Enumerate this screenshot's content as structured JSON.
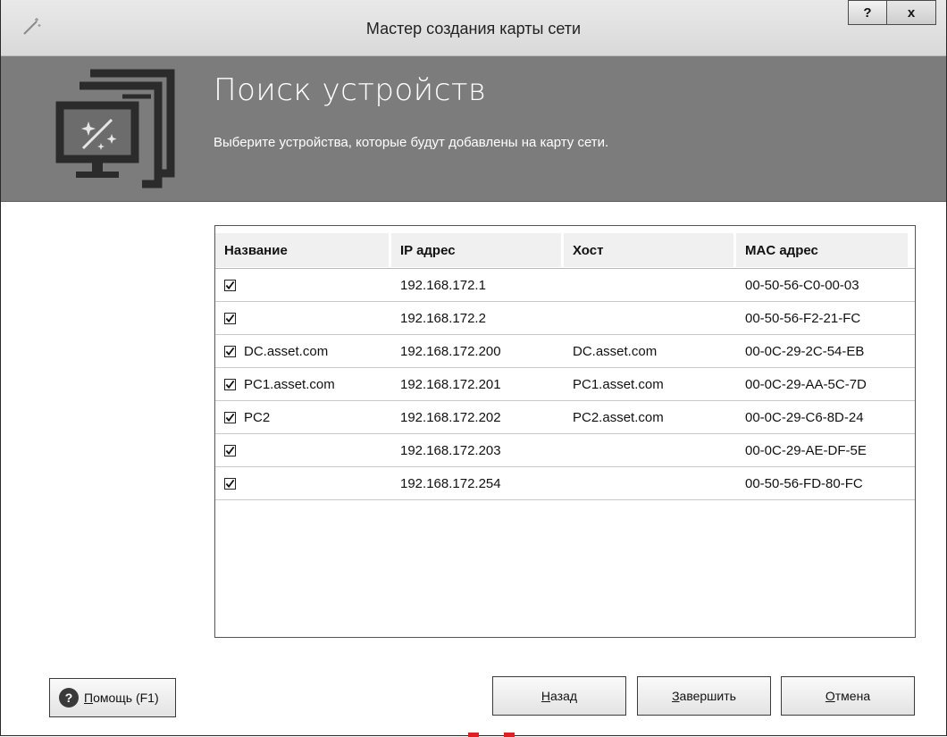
{
  "window": {
    "title": "Мастер создания карты сети",
    "help_button": "?",
    "close_button": "x"
  },
  "banner": {
    "heading": "Поиск устройств",
    "subtitle": "Выберите устройства, которые будут добавлены на карту сети."
  },
  "table": {
    "columns": [
      "Название",
      "IP адрес",
      "Хост",
      "MAC адрес"
    ],
    "rows": [
      {
        "checked": true,
        "name": "",
        "ip": "192.168.172.1",
        "host": "",
        "mac": "00-50-56-C0-00-03"
      },
      {
        "checked": true,
        "name": "",
        "ip": "192.168.172.2",
        "host": "",
        "mac": "00-50-56-F2-21-FC"
      },
      {
        "checked": true,
        "name": "DC.asset.com",
        "ip": "192.168.172.200",
        "host": "DC.asset.com",
        "mac": "00-0C-29-2C-54-EB"
      },
      {
        "checked": true,
        "name": "PC1.asset.com",
        "ip": "192.168.172.201",
        "host": "PC1.asset.com",
        "mac": "00-0C-29-AA-5C-7D"
      },
      {
        "checked": true,
        "name": "PC2",
        "ip": "192.168.172.202",
        "host": "PC2.asset.com",
        "mac": "00-0C-29-C6-8D-24"
      },
      {
        "checked": true,
        "name": "",
        "ip": "192.168.172.203",
        "host": "",
        "mac": "00-0C-29-AE-DF-5E"
      },
      {
        "checked": true,
        "name": "",
        "ip": "192.168.172.254",
        "host": "",
        "mac": "00-50-56-FD-80-FC"
      }
    ]
  },
  "buttons": {
    "help_first": "П",
    "help_rest": "омощь (F1)",
    "back_first": "Н",
    "back_rest": "азад",
    "finish_first": "З",
    "finish_rest": "авершить",
    "cancel_first": "О",
    "cancel_rest": "тмена"
  },
  "icons": {
    "title_icon": "magic-wand-icon",
    "banner_icon": "network-monitor-wand-icon",
    "help_icon": "question-circle-icon"
  },
  "colors": {
    "banner_bg": "#7c7c7c",
    "titlebar_bg": "#dedede"
  }
}
